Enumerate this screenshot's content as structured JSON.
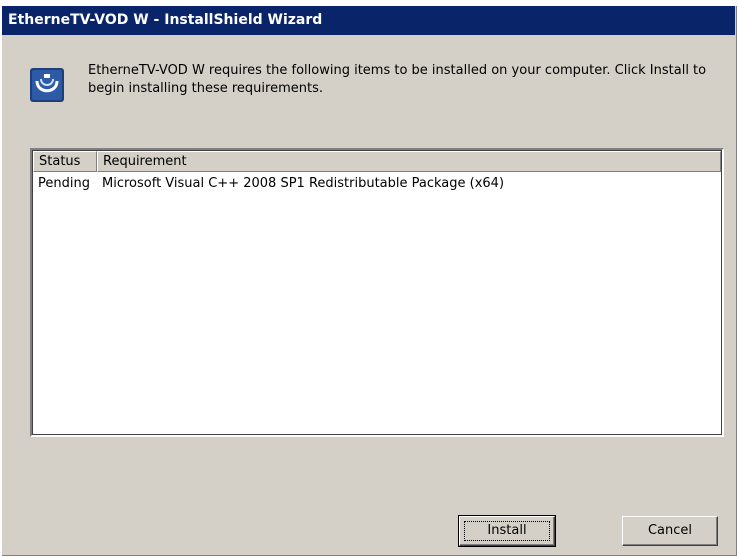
{
  "window": {
    "title": "EtherneTV-VOD W - InstallShield Wizard"
  },
  "message": {
    "text": "EtherneTV-VOD W requires the following items to be installed on your computer. Click Install to begin installing these requirements.",
    "icon": "installer-icon"
  },
  "requirements": {
    "columns": [
      "Status",
      "Requirement"
    ],
    "rows": [
      {
        "status": "Pending",
        "requirement": "Microsoft Visual C++ 2008 SP1 Redistributable Package (x64)"
      }
    ]
  },
  "buttons": {
    "install_label": "Install",
    "cancel_label": "Cancel"
  },
  "colors": {
    "titlebar": "#0a246a",
    "dialog_bg": "#d4d0c8"
  }
}
